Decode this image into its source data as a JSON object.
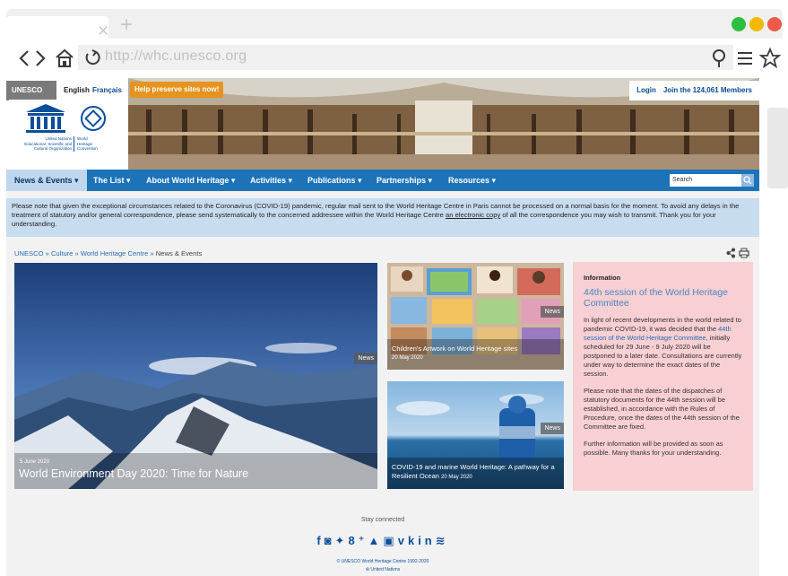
{
  "browser": {
    "url": "http://whc.unesco.org",
    "close_glyph": "×",
    "new_tab_glyph": "+"
  },
  "topbar": {
    "unesco": "UNESCO",
    "lang_en": "English",
    "lang_fr": "Français",
    "help": "Help preserve sites now!",
    "login": "Login",
    "join": "Join the 124,061 Members"
  },
  "logo": {
    "line1": "United Nations",
    "line2": "Educational, Scientific and",
    "line3": "Cultural Organization",
    "whc1": "World",
    "whc2": "Heritage",
    "whc3": "Convention"
  },
  "menu": {
    "items": [
      "News & Events ▾",
      "The List ▾",
      "About World Heritage ▾",
      "Activities ▾",
      "Publications ▾",
      "Partnerships ▾",
      "Resources ▾"
    ],
    "search": "Search"
  },
  "notice": {
    "text1": "Please note that given the exceptional circumstances related to the Coronavirus (COVID-19) pandemic, regular mail sent to the World Heritage Centre in Paris cannot be processed on a normal basis for the moment. To avoid any delays in the treatment of statutory and/or general correspondence, please send systematically to the concerned addressee within the World Heritage Centre ",
    "link": "an electronic copy",
    "text2": " of all the correspondence you may wish to transmit. Thank you for your understanding."
  },
  "breadcrumb": {
    "unesco": "UNESCO",
    "culture": "Culture",
    "whc": "World Heritage Centre",
    "current": "News & Events",
    "sep": " » "
  },
  "cards": {
    "main": {
      "badge": "News",
      "date": "5 June 2020",
      "title": "World Environment Day 2020: Time for Nature"
    },
    "kids": {
      "badge": "News",
      "title": "Children's Artwork on World Heritage sites",
      "date": "20 May 2020"
    },
    "ocean": {
      "badge": "News",
      "title": "COVID-19 and marine World Heritage: A pathway for a Resilient Ocean",
      "date": "20 May 2020"
    }
  },
  "info": {
    "heading": "Information",
    "title": "44th session of the World Heritage Committee",
    "p1a": "In light of recent developments in the world related to pandemic COVID-19, it was decided that the ",
    "p1link": "44th session of the World Heritage Committee",
    "p1b": ", initially scheduled for 29 June - 9 July 2020 will be postponed to a later date. Consultations are currently under way to determine the exact dates of the session.",
    "p2": "Please note that the dates of the dispatches of statutory documents for the 44th session will be established, in accordance with the Rules of Procedure, once the dates of the 44th session of the Committee are fixed.",
    "p3": "Further information will be provided as soon as possible. Many thanks for your understanding."
  },
  "footer": {
    "stay": "Stay connected",
    "copyright": "© UNESCO World Heritage Centre 1992-2020",
    "un": "United Nations"
  },
  "colors": {
    "menu": "#1c73b8",
    "help": "#e5941f",
    "info_bg": "#f8cfd2",
    "notice_bg": "#c8dcef",
    "dot_green": "#2dbf3f",
    "dot_yellow": "#f5b800",
    "dot_red": "#ee5a4a"
  }
}
